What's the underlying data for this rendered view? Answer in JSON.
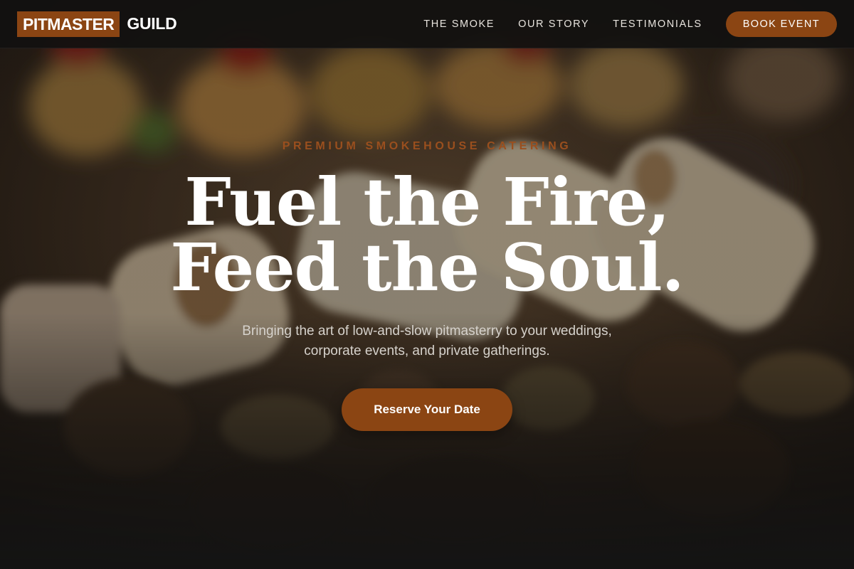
{
  "brand": {
    "name_boxed": "PITMASTER",
    "name_rest": "GUILD",
    "accent_color": "#8b4513"
  },
  "nav": {
    "links": [
      "THE SMOKE",
      "OUR STORY",
      "TESTIMONIALS"
    ],
    "cta_label": "BOOK EVENT"
  },
  "hero": {
    "eyebrow": "PREMIUM SMOKEHOUSE CATERING",
    "headline_line1": "Fuel the Fire,",
    "headline_line2": "Feed the Soul.",
    "subtitle_line1": "Bringing the art of low-and-slow pitmasterry to your weddings,",
    "subtitle_line2": "corporate events, and private gatherings.",
    "button_label": "Reserve Your Date"
  }
}
